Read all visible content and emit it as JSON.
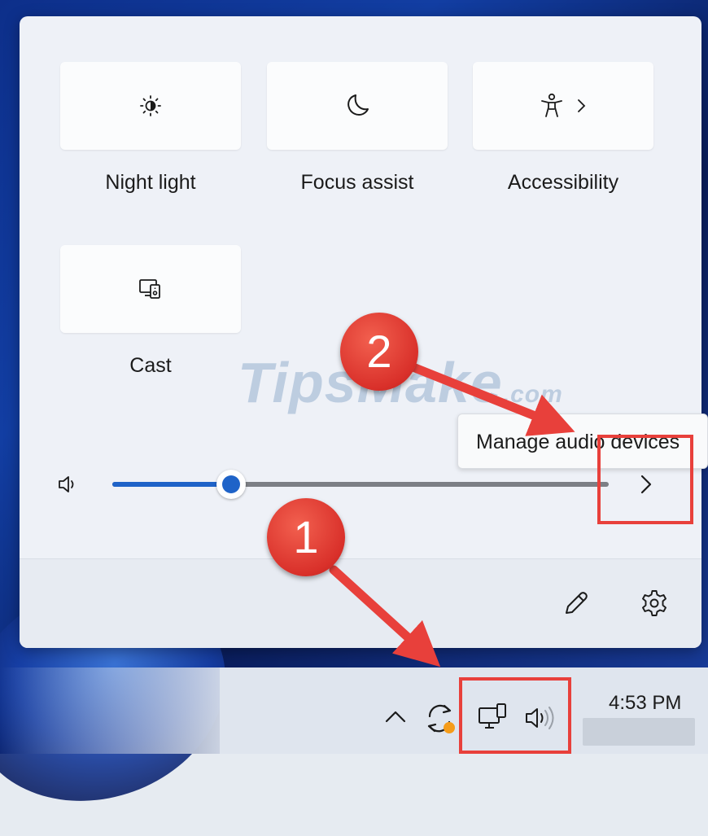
{
  "quick_settings": {
    "tiles": [
      {
        "label": "Night light",
        "icon": "brightness-icon"
      },
      {
        "label": "Focus assist",
        "icon": "moon-icon"
      },
      {
        "label": "Accessibility",
        "icon": "accessibility-icon"
      },
      {
        "label": "Cast",
        "icon": "cast-icon"
      }
    ],
    "volume": {
      "level_percent": 24,
      "icon": "speaker-icon",
      "expand_icon": "chevron-right-icon",
      "tooltip": "Manage audio devices"
    },
    "footer": {
      "edit_icon": "pencil-icon",
      "settings_icon": "gear-icon"
    }
  },
  "taskbar": {
    "clock": "4:53 PM",
    "tray_icons": [
      "chevron-up-icon",
      "sync-update-icon",
      "network-icon",
      "speaker-icon"
    ]
  },
  "annotations": {
    "watermark": "TipsMake",
    "watermark_suffix": ".com",
    "step_1": "1",
    "step_2": "2",
    "highlight_color": "#e8403b"
  },
  "colors": {
    "accent": "#1f63c8",
    "update_badge": "#f59c1a"
  }
}
